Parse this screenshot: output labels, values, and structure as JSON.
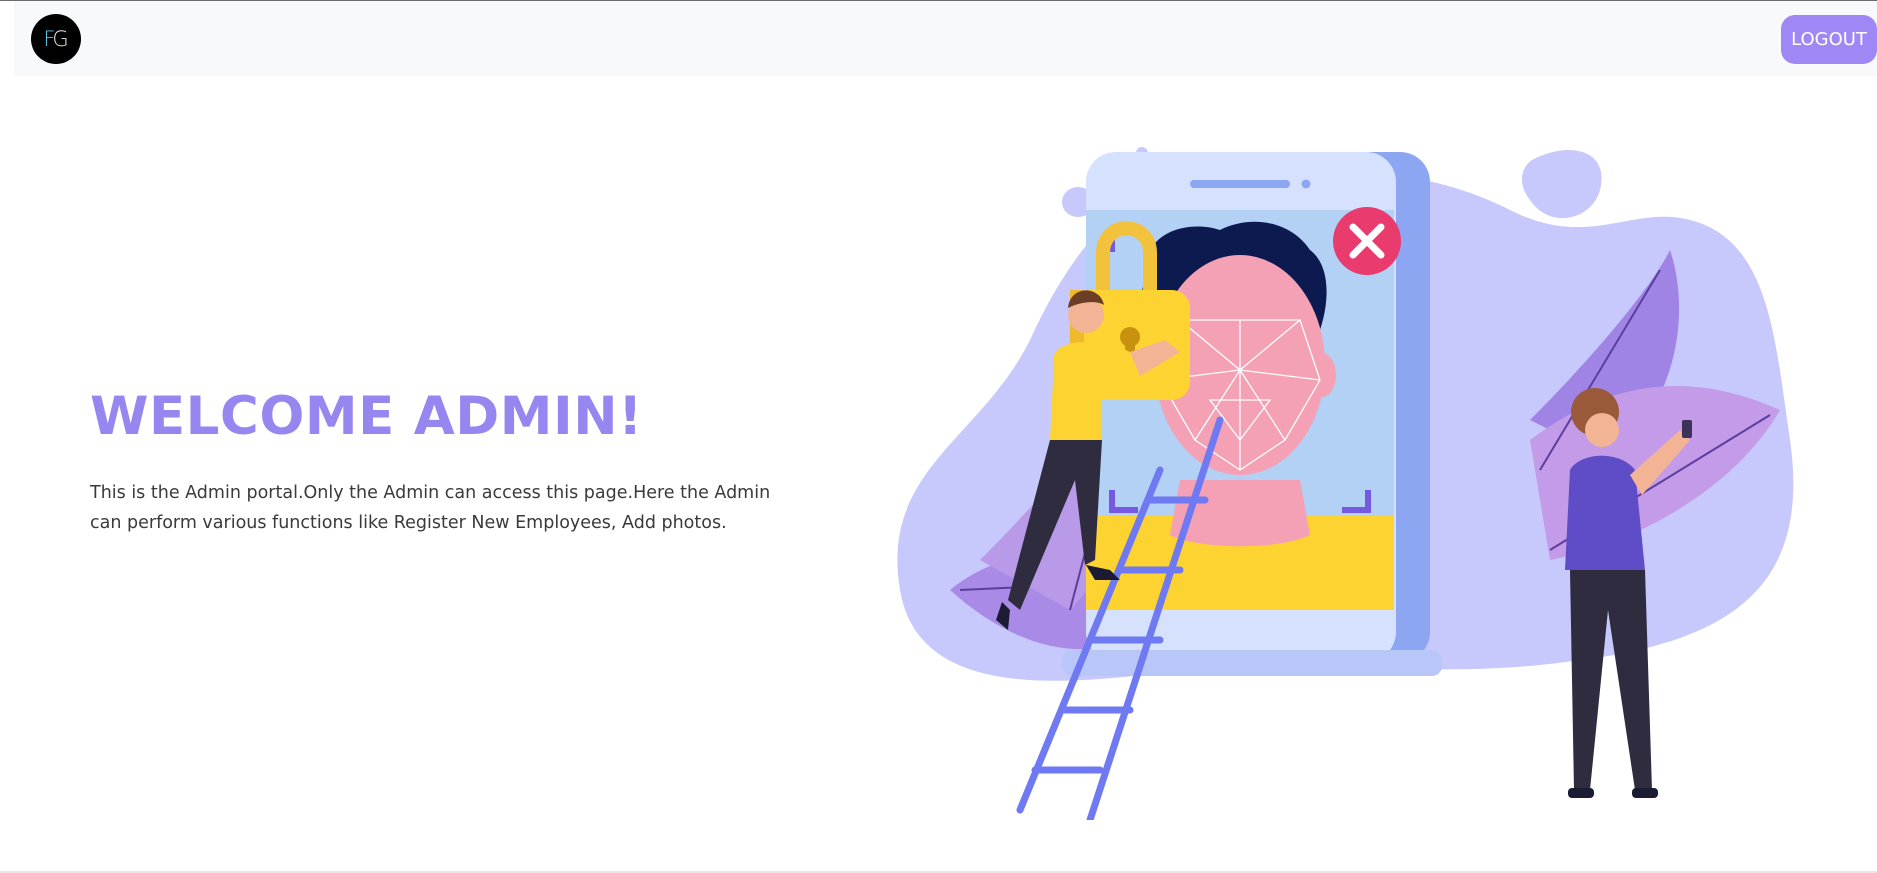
{
  "navbar": {
    "logo_text": "FG",
    "logout_label": "LOGOUT"
  },
  "hero": {
    "title": "WELCOME ADMIN!",
    "description": "This is the Admin portal.Only the Admin can access this page.Here the Admin can perform various functions like Register New Employees, Add photos."
  },
  "colors": {
    "accent": "#9686f0",
    "logout_button": "#9f88f6",
    "navbar_bg": "#f8f9fa",
    "logo_bg": "#000000"
  },
  "illustration": {
    "icons": [
      "padlock-icon",
      "face-scan-icon",
      "close-x-icon"
    ]
  }
}
